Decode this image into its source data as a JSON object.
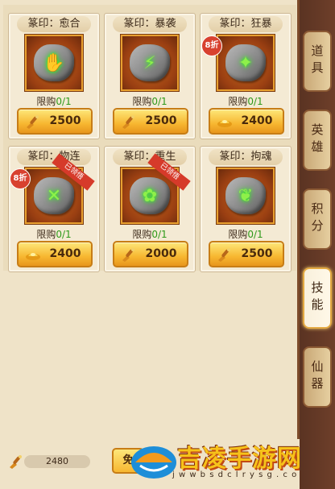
{
  "shop": {
    "items": [
      {
        "name": "篆印：愈合",
        "limit_label": "限购",
        "limit_count": "0/1",
        "price": "2500",
        "rune": "✋",
        "currency": "brush-icon",
        "discount": "",
        "sold": ""
      },
      {
        "name": "篆印：暴袭",
        "limit_label": "限购",
        "limit_count": "0/1",
        "price": "2500",
        "rune": "⚡",
        "currency": "brush-icon",
        "discount": "",
        "sold": ""
      },
      {
        "name": "篆印：狂暴",
        "limit_label": "限购",
        "limit_count": "0/1",
        "price": "2400",
        "rune": "✦",
        "currency": "gold-ingot-icon",
        "discount": "8折",
        "sold": ""
      },
      {
        "name": "篆印：物连",
        "limit_label": "限购",
        "limit_count": "0/1",
        "price": "2400",
        "rune": "✕",
        "currency": "gold-ingot-icon",
        "discount": "8折",
        "sold": "已领悟"
      },
      {
        "name": "篆印：重生",
        "limit_label": "限购",
        "limit_count": "0/1",
        "price": "2000",
        "rune": "✿",
        "currency": "brush-icon",
        "discount": "",
        "sold": "已领悟"
      },
      {
        "name": "篆印：拘魂",
        "limit_label": "限购",
        "limit_count": "0/1",
        "price": "2500",
        "rune": "❦",
        "currency": "brush-icon",
        "discount": "",
        "sold": ""
      }
    ]
  },
  "footer": {
    "currency_amount": "2480",
    "free_button": "免"
  },
  "tabs": [
    {
      "label": "道具",
      "active": false
    },
    {
      "label": "英雄",
      "active": false
    },
    {
      "label": "积分",
      "active": false
    },
    {
      "label": "技能",
      "active": true
    },
    {
      "label": "仙器",
      "active": false
    }
  ],
  "watermark": {
    "title": "吉凌手游网",
    "url": "j w w b s d c l r y s g . c o m"
  },
  "colors": {
    "accent": "#f7b731",
    "panel": "#efe3c8",
    "tab_bar": "#5a3322",
    "limit_count": "#2e9a1a",
    "discount": "#d8412f"
  }
}
